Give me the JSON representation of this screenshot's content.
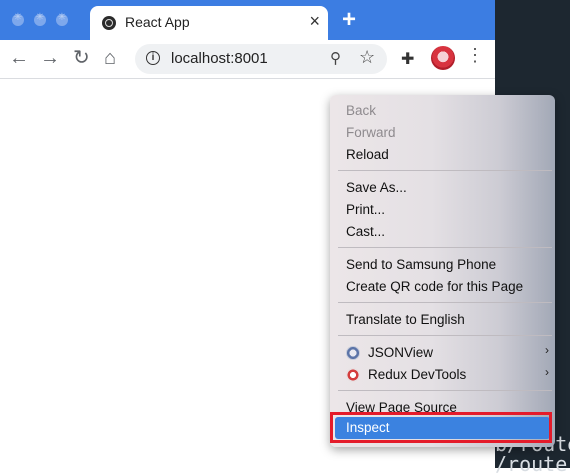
{
  "browser": {
    "tab_title": "React App",
    "tab_close": "×",
    "new_tab": "+",
    "url": "localhost:8001",
    "icons": {
      "back": "←",
      "forward": "→",
      "reload": "↻",
      "home": "⌂",
      "info": "i",
      "zoom": "⚲",
      "star": "☆",
      "extensions": "✚",
      "menu": "⋮"
    }
  },
  "context_menu": {
    "items": [
      {
        "label": "Back",
        "disabled": true
      },
      {
        "label": "Forward",
        "disabled": true
      },
      {
        "label": "Reload",
        "disabled": false
      },
      {
        "label": "Save As...",
        "disabled": false
      },
      {
        "label": "Print...",
        "disabled": false
      },
      {
        "label": "Cast...",
        "disabled": false
      },
      {
        "label": "Send to Samsung Phone",
        "disabled": false
      },
      {
        "label": "Create QR code for this Page",
        "disabled": false
      },
      {
        "label": "Translate to English",
        "disabled": false
      },
      {
        "label": "JSONView",
        "disabled": false,
        "submenu": true
      },
      {
        "label": "Redux DevTools",
        "disabled": false,
        "submenu": true
      },
      {
        "label": "View Page Source",
        "disabled": false
      },
      {
        "label": "Inspect",
        "disabled": false,
        "highlighted": true
      }
    ],
    "submenu_arrow": "›",
    "highlight_color": "#3b82e0",
    "annotation_color": "#e41b2a"
  },
  "terminal": {
    "line1": "b/route",
    "line2": "/router"
  }
}
